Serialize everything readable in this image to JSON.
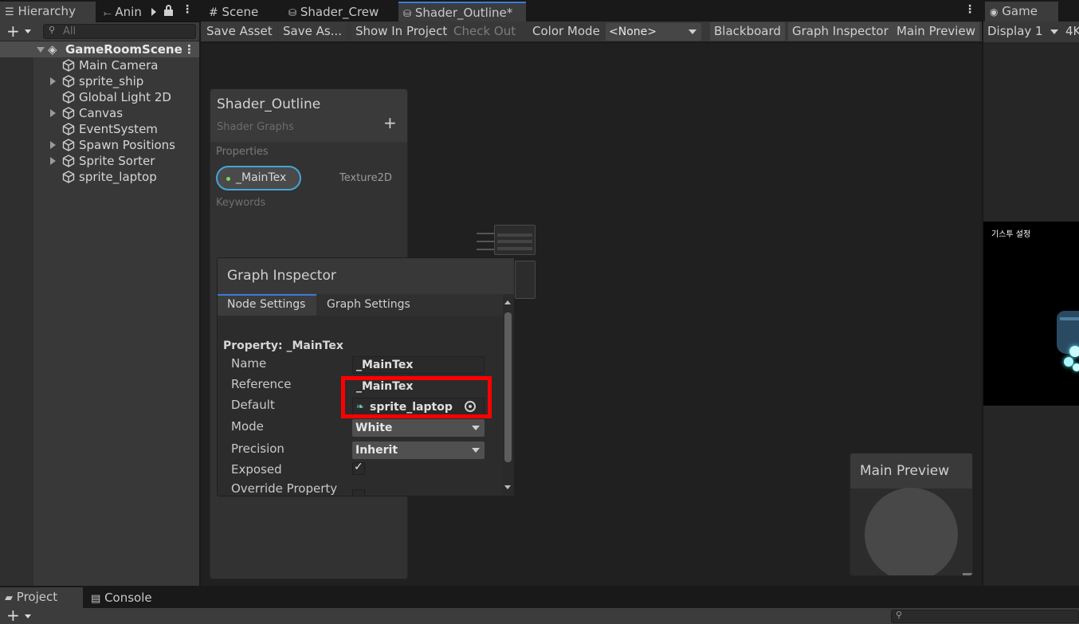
{
  "hierarchy": {
    "tab_label": "Hierarchy",
    "tab2_label": "Anin",
    "search_placeholder": "All",
    "scene_name": "GameRoomScene",
    "items": [
      {
        "label": "Main Camera",
        "has_children": false
      },
      {
        "label": "sprite_ship",
        "has_children": true
      },
      {
        "label": "Global Light 2D",
        "has_children": false
      },
      {
        "label": "Canvas",
        "has_children": true
      },
      {
        "label": "EventSystem",
        "has_children": false
      },
      {
        "label": "Spawn Positions",
        "has_children": true
      },
      {
        "label": "Sprite Sorter",
        "has_children": true
      },
      {
        "label": "sprite_laptop",
        "has_children": false
      }
    ]
  },
  "editor_tabs": [
    "Scene",
    "Shader_Crew",
    "Shader_Outline*"
  ],
  "toolbar": {
    "save_asset": "Save Asset",
    "save_as": "Save As...",
    "show_in_project": "Show In Project",
    "check_out": "Check Out",
    "color_mode_label": "Color Mode",
    "color_mode_value": "<None>",
    "blackboard": "Blackboard",
    "graph_inspector": "Graph Inspector",
    "main_preview": "Main Preview"
  },
  "blackboard": {
    "title": "Shader_Outline",
    "subtitle": "Shader Graphs",
    "properties_header": "Properties",
    "property_name": "_MainTex",
    "property_type": "Texture2D",
    "keywords_header": "Keywords"
  },
  "inspector": {
    "title": "Graph Inspector",
    "tabs": [
      "Node Settings",
      "Graph Settings"
    ],
    "section_title": "Property: _MainTex",
    "fields": {
      "name_label": "Name",
      "name_value": "_MainTex",
      "reference_label": "Reference",
      "reference_value": "_MainTex",
      "default_label": "Default",
      "default_value": "sprite_laptop",
      "mode_label": "Mode",
      "mode_value": "White",
      "precision_label": "Precision",
      "precision_value": "Inherit",
      "exposed_label": "Exposed",
      "override_label": "Override Property"
    }
  },
  "main_preview": {
    "title": "Main Preview"
  },
  "game": {
    "tab_label": "Game",
    "display": "Display 1",
    "resolution": "4K",
    "overlay_text": "기스투 설정"
  },
  "bottom": {
    "project_tab": "Project",
    "console_tab": "Console"
  },
  "colors": {
    "highlight": "#ff0000",
    "accent": "#3a7ad8",
    "property_dot": "#7fd65a"
  }
}
